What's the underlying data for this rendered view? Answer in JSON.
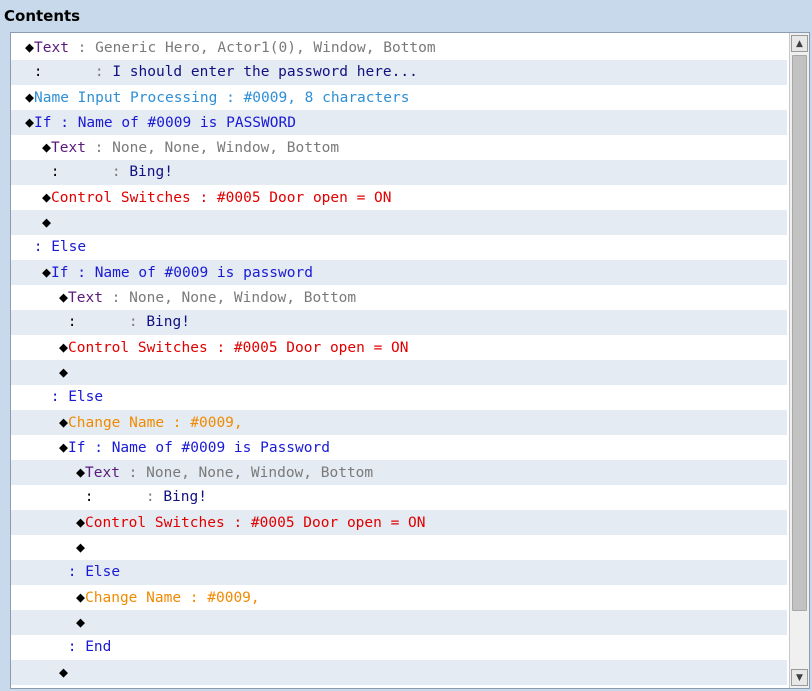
{
  "panel": {
    "title": "Contents"
  },
  "rows": [
    {
      "indent": 0,
      "parts": [
        [
          "◆",
          "diamond"
        ],
        [
          "Text",
          "c-text"
        ],
        [
          " : ",
          "c-gray"
        ],
        [
          "Generic Hero, Actor1(0), Window, Bottom",
          "c-gray"
        ]
      ]
    },
    {
      "indent": 0,
      "parts": [
        [
          " :      ",
          "colon"
        ],
        [
          ": ",
          "c-gray"
        ],
        [
          "I should enter the password here...",
          "c-navy"
        ]
      ]
    },
    {
      "indent": 0,
      "parts": [
        [
          "◆",
          "diamond"
        ],
        [
          "Name Input Processing",
          "c-sky"
        ],
        [
          " : ",
          "c-sky"
        ],
        [
          "#0009, 8 characters",
          "c-sky"
        ]
      ]
    },
    {
      "indent": 0,
      "parts": [
        [
          "◆",
          "diamond"
        ],
        [
          "If",
          "c-blue"
        ],
        [
          " : ",
          "c-blue"
        ],
        [
          "Name of #0009 is PASSWORD",
          "c-blue"
        ]
      ]
    },
    {
      "indent": 1,
      "parts": [
        [
          "◆",
          "diamond"
        ],
        [
          "Text",
          "c-text"
        ],
        [
          " : ",
          "c-gray"
        ],
        [
          "None, None, Window, Bottom",
          "c-gray"
        ]
      ]
    },
    {
      "indent": 1,
      "parts": [
        [
          " :      ",
          "colon"
        ],
        [
          ": ",
          "c-gray"
        ],
        [
          "Bing!",
          "c-navy"
        ]
      ]
    },
    {
      "indent": 1,
      "parts": [
        [
          "◆",
          "diamond"
        ],
        [
          "Control Switches",
          "c-red"
        ],
        [
          " : ",
          "c-red"
        ],
        [
          "#0005 Door open = ON",
          "c-red"
        ]
      ]
    },
    {
      "indent": 1,
      "parts": [
        [
          "◆",
          "diamond"
        ]
      ]
    },
    {
      "indent": 0,
      "parts": [
        [
          " : ",
          "c-blue"
        ],
        [
          "Else",
          "c-blue"
        ]
      ]
    },
    {
      "indent": 1,
      "parts": [
        [
          "◆",
          "diamond"
        ],
        [
          "If",
          "c-blue"
        ],
        [
          " : ",
          "c-blue"
        ],
        [
          "Name of #0009 is password",
          "c-blue"
        ]
      ]
    },
    {
      "indent": 2,
      "parts": [
        [
          "◆",
          "diamond"
        ],
        [
          "Text",
          "c-text"
        ],
        [
          " : ",
          "c-gray"
        ],
        [
          "None, None, Window, Bottom",
          "c-gray"
        ]
      ]
    },
    {
      "indent": 2,
      "parts": [
        [
          " :      ",
          "colon"
        ],
        [
          ": ",
          "c-gray"
        ],
        [
          "Bing!",
          "c-navy"
        ]
      ]
    },
    {
      "indent": 2,
      "parts": [
        [
          "◆",
          "diamond"
        ],
        [
          "Control Switches",
          "c-red"
        ],
        [
          " : ",
          "c-red"
        ],
        [
          "#0005 Door open = ON",
          "c-red"
        ]
      ]
    },
    {
      "indent": 2,
      "parts": [
        [
          "◆",
          "diamond"
        ]
      ]
    },
    {
      "indent": 1,
      "parts": [
        [
          " : ",
          "c-blue"
        ],
        [
          "Else",
          "c-blue"
        ]
      ]
    },
    {
      "indent": 2,
      "parts": [
        [
          "◆",
          "diamond"
        ],
        [
          "Change Name",
          "c-orange"
        ],
        [
          " : ",
          "c-orange"
        ],
        [
          "#0009,",
          "c-orange"
        ]
      ]
    },
    {
      "indent": 2,
      "parts": [
        [
          "◆",
          "diamond"
        ],
        [
          "If",
          "c-blue"
        ],
        [
          " : ",
          "c-blue"
        ],
        [
          "Name of #0009 is Password",
          "c-blue"
        ]
      ]
    },
    {
      "indent": 3,
      "parts": [
        [
          "◆",
          "diamond"
        ],
        [
          "Text",
          "c-text"
        ],
        [
          " : ",
          "c-gray"
        ],
        [
          "None, None, Window, Bottom",
          "c-gray"
        ]
      ]
    },
    {
      "indent": 3,
      "parts": [
        [
          " :      ",
          "colon"
        ],
        [
          ": ",
          "c-gray"
        ],
        [
          "Bing!",
          "c-navy"
        ]
      ]
    },
    {
      "indent": 3,
      "parts": [
        [
          "◆",
          "diamond"
        ],
        [
          "Control Switches",
          "c-red"
        ],
        [
          " : ",
          "c-red"
        ],
        [
          "#0005 Door open = ON",
          "c-red"
        ]
      ]
    },
    {
      "indent": 3,
      "parts": [
        [
          "◆",
          "diamond"
        ]
      ]
    },
    {
      "indent": 2,
      "parts": [
        [
          " : ",
          "c-blue"
        ],
        [
          "Else",
          "c-blue"
        ]
      ]
    },
    {
      "indent": 3,
      "parts": [
        [
          "◆",
          "diamond"
        ],
        [
          "Change Name",
          "c-orange"
        ],
        [
          " : ",
          "c-orange"
        ],
        [
          "#0009,",
          "c-orange"
        ]
      ]
    },
    {
      "indent": 3,
      "parts": [
        [
          "◆",
          "diamond"
        ]
      ]
    },
    {
      "indent": 2,
      "parts": [
        [
          " : ",
          "c-blue"
        ],
        [
          "End",
          "c-blue"
        ]
      ]
    },
    {
      "indent": 2,
      "parts": [
        [
          "◆",
          "diamond"
        ]
      ]
    }
  ],
  "scrollbar": {
    "up_icon": "arrow-up-icon",
    "down_icon": "arrow-down-icon"
  }
}
